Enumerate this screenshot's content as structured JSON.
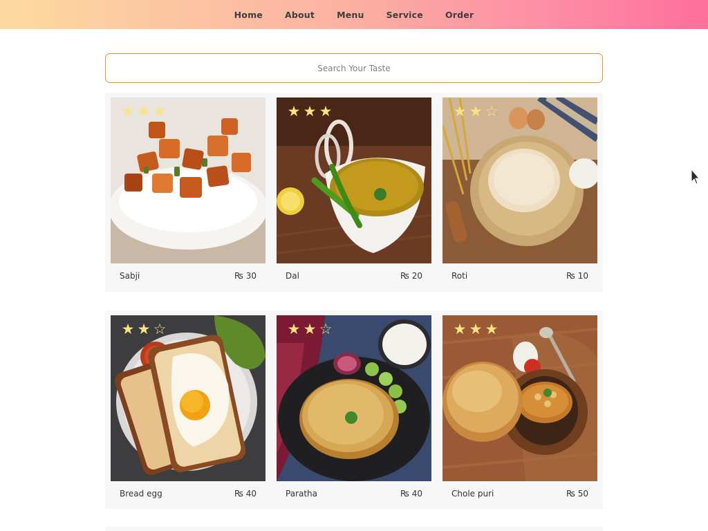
{
  "nav": {
    "items": [
      {
        "label": "Home"
      },
      {
        "label": "About"
      },
      {
        "label": "Menu"
      },
      {
        "label": "Service"
      },
      {
        "label": "Order"
      }
    ]
  },
  "search": {
    "placeholder": "Search Your Taste"
  },
  "menu": {
    "items": [
      {
        "name": "Sabji",
        "price": "₨ 30",
        "stars": 3,
        "image": "sabji-photo"
      },
      {
        "name": "Dal",
        "price": "₨ 20",
        "stars": 3,
        "image": "dal-photo"
      },
      {
        "name": "Roti",
        "price": "₨ 10",
        "stars": 2,
        "image": "roti-photo"
      },
      {
        "name": "Bread egg",
        "price": "₨ 40",
        "stars": 2,
        "image": "bread-egg-photo"
      },
      {
        "name": "Paratha",
        "price": "₨ 40",
        "stars": 2,
        "image": "paratha-photo"
      },
      {
        "name": "Chole puri",
        "price": "₨ 50",
        "stars": 3,
        "image": "chole-puri-photo"
      }
    ]
  },
  "rating": {
    "max": 5,
    "shown": 3,
    "star_color": "#fbe383"
  },
  "colors": {
    "nav_gradient_start": "#fdd9a0",
    "nav_gradient_end": "#ff6f9d",
    "search_border": "#e8902a",
    "card_bg": "#f7f7f8"
  }
}
